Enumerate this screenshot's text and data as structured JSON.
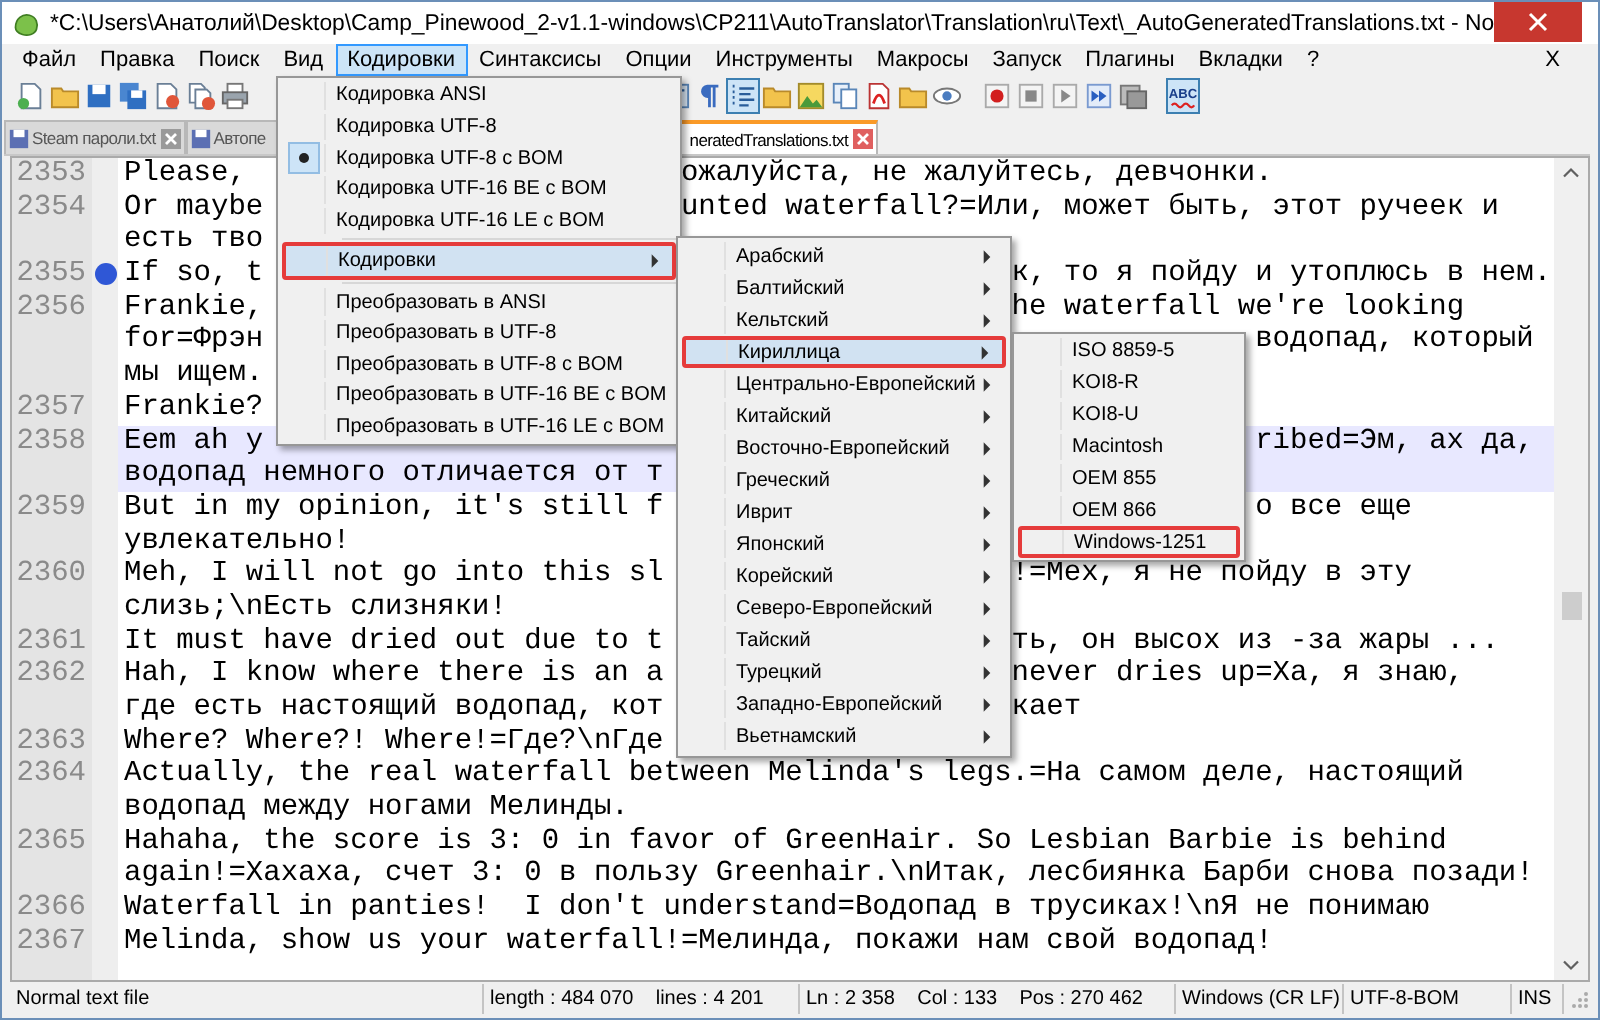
{
  "window": {
    "title": "*C:\\Users\\Анатолий\\Desktop\\Camp_Pinewood_2-v1.1-windows\\CP211\\AutoTranslator\\Translation\\ru\\Text\\_AutoGeneratedTranslations.txt - No"
  },
  "menubar": {
    "items": [
      {
        "label": "Файл",
        "selected": false
      },
      {
        "label": "Правка",
        "selected": false
      },
      {
        "label": "Поиск",
        "selected": false
      },
      {
        "label": "Вид",
        "selected": false
      },
      {
        "label": "Кодировки",
        "selected": true
      },
      {
        "label": "Синтаксисы",
        "selected": false
      },
      {
        "label": "Опции",
        "selected": false
      },
      {
        "label": "Инструменты",
        "selected": false
      },
      {
        "label": "Макросы",
        "selected": false
      },
      {
        "label": "Запуск",
        "selected": false
      },
      {
        "label": "Плагины",
        "selected": false
      },
      {
        "label": "Вкладки",
        "selected": false
      },
      {
        "label": "?",
        "selected": false
      }
    ],
    "close_label": "X"
  },
  "toolbar": {
    "buttons": [
      {
        "pressed": false
      },
      {
        "pressed": false
      },
      {
        "pressed": false
      },
      {
        "pressed": false
      },
      {
        "pressed": false
      },
      {
        "pressed": false
      },
      {
        "pressed": false
      },
      {
        "pressed": false
      },
      {
        "pressed": false
      },
      {
        "pressed": true
      },
      {
        "pressed": false
      },
      {
        "pressed": false
      },
      {
        "pressed": false
      },
      {
        "pressed": false
      },
      {
        "pressed": false
      },
      {
        "pressed": false
      },
      {
        "pressed": false
      },
      {
        "pressed": false
      },
      {
        "pressed": false
      },
      {
        "pressed": false
      },
      {
        "pressed": false
      },
      {
        "pressed": true,
        "label": "ABC"
      }
    ]
  },
  "tabs": [
    {
      "label": "Steam пароли.txt",
      "selected": false
    },
    {
      "label": "Автопе",
      "selected": false
    },
    {
      "label": "neratedTranslations.txt",
      "selected": true
    }
  ],
  "editor": {
    "lines": [
      {
        "number": "2353",
        "bookmark": false,
        "current": false,
        "rows": [
          {
            "left": "Please,",
            "right": "ожалуйста, не жалуйтесь, девчонки."
          }
        ]
      },
      {
        "number": "2354",
        "bookmark": false,
        "current": false,
        "rows": [
          {
            "left": "Or maybe",
            "right": "unted waterfall?=Или, может быть, этот ручеек и"
          },
          {
            "left": "есть тво"
          }
        ]
      },
      {
        "number": "2355",
        "bookmark": true,
        "current": false,
        "rows": [
          {
            "left": "If so, t",
            "right": "к, то я пойду и утоплюсь в нем."
          }
        ]
      },
      {
        "number": "2356",
        "bookmark": false,
        "current": false,
        "rows": [
          {
            "left": "Frankie,",
            "right": "he waterfall we're looking"
          },
          {
            "left": "for=Фрэн",
            "right": "водопад, который"
          },
          {
            "left": "мы ищем."
          }
        ]
      },
      {
        "number": "2357",
        "bookmark": false,
        "current": false,
        "rows": [
          {
            "left": "Frankie?"
          }
        ]
      },
      {
        "number": "2358",
        "bookmark": false,
        "current": true,
        "rows": [
          {
            "left": "Eem ah y",
            "right": "ribed=Эм, ах да,"
          },
          {
            "left": "водопад немного отличается от т"
          }
        ]
      },
      {
        "number": "2359",
        "bookmark": false,
        "current": false,
        "rows": [
          {
            "left": "But in my opinion, it's still f",
            "right": "о все еще"
          },
          {
            "left": "увлекательно!"
          }
        ]
      },
      {
        "number": "2360",
        "bookmark": false,
        "current": false,
        "rows": [
          {
            "left": "Meh, I will not go into this sl",
            "right": "!=Мех, я не пойду в эту"
          },
          {
            "left": "слизь;\\nЕсть слизняки!"
          }
        ]
      },
      {
        "number": "2361",
        "bookmark": false,
        "current": false,
        "rows": [
          {
            "left": "It must have dried out due to t",
            "right": "ть, он высох из -за жары ..."
          }
        ]
      },
      {
        "number": "2362",
        "bookmark": false,
        "current": false,
        "rows": [
          {
            "left": "Hah, I know where there is an a",
            "right": "never dries up=Ха, я знаю,"
          },
          {
            "left": "где есть настоящий водопад, кот",
            "right": "кает"
          }
        ]
      },
      {
        "number": "2363",
        "bookmark": false,
        "current": false,
        "rows": [
          {
            "left": "Where? Where?! Where!=Где?\\nГде"
          }
        ]
      },
      {
        "number": "2364",
        "bookmark": false,
        "current": false,
        "rows": [
          {
            "left": "Actually, the real waterfall between Melinda's legs.=На самом деле, настоящий"
          },
          {
            "left": "водопад между ногами Мелинды."
          }
        ]
      },
      {
        "number": "2365",
        "bookmark": false,
        "current": false,
        "rows": [
          {
            "left": "Hahaha, the score is 3: 0 in favor of GreenHair. So Lesbian Barbie is behind"
          },
          {
            "left": "again!=Хахаха, счет 3: 0 в пользу Greenhair.\\nИтак, лесбиянка Барби снова позади!"
          }
        ]
      },
      {
        "number": "2366",
        "bookmark": false,
        "current": false,
        "rows": [
          {
            "left": "Waterfall in panties!  I don't understand=Водопад в трусиках!\\nЯ не понимаю"
          }
        ]
      },
      {
        "number": "2367",
        "bookmark": false,
        "current": false,
        "rows": [
          {
            "left": "Melinda, show us your waterfall!=Мелинда, покажи нам свой водопад!"
          }
        ]
      }
    ]
  },
  "menus": [
    {
      "items": [
        {
          "kind": "option",
          "label": "Кодировка ANSI",
          "selected": false,
          "highlighted": false,
          "outlined": false
        },
        {
          "kind": "option",
          "label": "Кодировка UTF-8",
          "selected": false,
          "highlighted": false,
          "outlined": false
        },
        {
          "kind": "option",
          "label": "Кодировка UTF-8 с BOM",
          "selected": true,
          "highlighted": false,
          "outlined": false
        },
        {
          "kind": "option",
          "label": "Кодировка UTF-16 BE с BOM",
          "selected": false,
          "highlighted": false,
          "outlined": false
        },
        {
          "kind": "option",
          "label": "Кодировка UTF-16 LE с BOM",
          "selected": false,
          "highlighted": false,
          "outlined": false
        },
        {
          "kind": "separator"
        },
        {
          "kind": "submenu",
          "label": "Кодировки",
          "highlighted": true,
          "outlined": true
        },
        {
          "kind": "separator"
        },
        {
          "kind": "command",
          "label": "Преобразовать в ANSI",
          "highlighted": false,
          "outlined": false
        },
        {
          "kind": "command",
          "label": "Преобразовать в UTF-8",
          "highlighted": false,
          "outlined": false
        },
        {
          "kind": "command",
          "label": "Преобразовать в UTF-8 с BOM",
          "highlighted": false,
          "outlined": false
        },
        {
          "kind": "command",
          "label": "Преобразовать в UTF-16 BE с BOM",
          "highlighted": false,
          "outlined": false
        },
        {
          "kind": "command",
          "label": "Преобразовать в UTF-16 LE с BOM",
          "highlighted": false,
          "outlined": false
        }
      ]
    },
    {
      "items": [
        {
          "kind": "submenu",
          "label": "Арабский",
          "highlighted": false,
          "outlined": false
        },
        {
          "kind": "submenu",
          "label": "Балтийский",
          "highlighted": false,
          "outlined": false
        },
        {
          "kind": "submenu",
          "label": "Кельтский",
          "highlighted": false,
          "outlined": false
        },
        {
          "kind": "submenu",
          "label": "Кириллица",
          "highlighted": true,
          "outlined": true
        },
        {
          "kind": "submenu",
          "label": "Центрально-Европейский",
          "highlighted": false,
          "outlined": false
        },
        {
          "kind": "submenu",
          "label": "Китайский",
          "highlighted": false,
          "outlined": false
        },
        {
          "kind": "submenu",
          "label": "Восточно-Европейский",
          "highlighted": false,
          "outlined": false
        },
        {
          "kind": "submenu",
          "label": "Греческий",
          "highlighted": false,
          "outlined": false
        },
        {
          "kind": "submenu",
          "label": "Иврит",
          "highlighted": false,
          "outlined": false
        },
        {
          "kind": "submenu",
          "label": "Японский",
          "highlighted": false,
          "outlined": false
        },
        {
          "kind": "submenu",
          "label": "Корейский",
          "highlighted": false,
          "outlined": false
        },
        {
          "kind": "submenu",
          "label": "Северо-Европейский",
          "highlighted": false,
          "outlined": false
        },
        {
          "kind": "submenu",
          "label": "Тайский",
          "highlighted": false,
          "outlined": false
        },
        {
          "kind": "submenu",
          "label": "Турецкий",
          "highlighted": false,
          "outlined": false
        },
        {
          "kind": "submenu",
          "label": "Западно-Европейский",
          "highlighted": false,
          "outlined": false
        },
        {
          "kind": "submenu",
          "label": "Вьетнамский",
          "highlighted": false,
          "outlined": false
        }
      ]
    },
    {
      "items": [
        {
          "kind": "option",
          "label": "ISO 8859-5",
          "selected": false,
          "highlighted": false,
          "outlined": false
        },
        {
          "kind": "option",
          "label": "KOI8-R",
          "selected": false,
          "highlighted": false,
          "outlined": false
        },
        {
          "kind": "option",
          "label": "KOI8-U",
          "selected": false,
          "highlighted": false,
          "outlined": false
        },
        {
          "kind": "option",
          "label": "Macintosh",
          "selected": false,
          "highlighted": false,
          "outlined": false
        },
        {
          "kind": "option",
          "label": "OEM 855",
          "selected": false,
          "highlighted": false,
          "outlined": false
        },
        {
          "kind": "option",
          "label": "OEM 866",
          "selected": false,
          "highlighted": false,
          "outlined": false
        },
        {
          "kind": "option",
          "label": "Windows-1251",
          "selected": false,
          "highlighted": false,
          "outlined": true
        }
      ]
    }
  ],
  "status_bar": [
    "Normal text file",
    "length : 484 070    lines : 4 201",
    "Ln : 2 358    Col : 133    Pos : 270 462",
    "Windows (CR LF)",
    "UTF-8-BOM",
    "INS"
  ]
}
